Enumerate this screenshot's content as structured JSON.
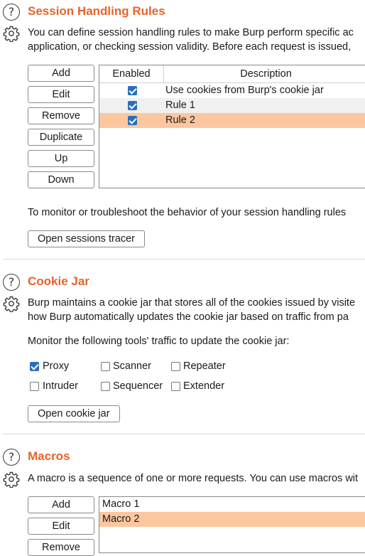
{
  "session": {
    "title": "Session Handling Rules",
    "desc_line1": "You can define session handling rules to make Burp perform specific ac",
    "desc_line2": "application, or checking session validity. Before each request is issued,",
    "buttons": {
      "add": "Add",
      "edit": "Edit",
      "remove": "Remove",
      "duplicate": "Duplicate",
      "up": "Up",
      "down": "Down"
    },
    "table": {
      "col_enabled": "Enabled",
      "col_description": "Description",
      "rows": [
        {
          "enabled": true,
          "description": "Use cookies from Burp's cookie jar"
        },
        {
          "enabled": true,
          "description": "Rule 1"
        },
        {
          "enabled": true,
          "description": "Rule 2"
        }
      ]
    },
    "monitor_text": "To monitor or troubleshoot the behavior of your session handling rules",
    "tracer_button": "Open sessions tracer"
  },
  "cookie_jar": {
    "title": "Cookie Jar",
    "desc_line1": "Burp maintains a cookie jar that stores all of the cookies issued by visite",
    "desc_line2": "how Burp automatically updates the cookie jar based on traffic from pa",
    "monitor_label": "Monitor the following tools' traffic to update the cookie jar:",
    "tools": [
      {
        "label": "Proxy",
        "checked": true
      },
      {
        "label": "Scanner",
        "checked": false
      },
      {
        "label": "Repeater",
        "checked": false
      },
      {
        "label": "Intruder",
        "checked": false
      },
      {
        "label": "Sequencer",
        "checked": false
      },
      {
        "label": "Extender",
        "checked": false
      }
    ],
    "open_button": "Open cookie jar"
  },
  "macros": {
    "title": "Macros",
    "desc_line1": "A macro is a sequence of one or more requests. You can use macros wit",
    "buttons": {
      "add": "Add",
      "edit": "Edit",
      "remove": "Remove"
    },
    "items": [
      "Macro 1",
      "Macro 2"
    ]
  },
  "colors": {
    "accent": "#e8632b",
    "selection": "#fcc79f",
    "checkbox": "#2a6ebd"
  }
}
